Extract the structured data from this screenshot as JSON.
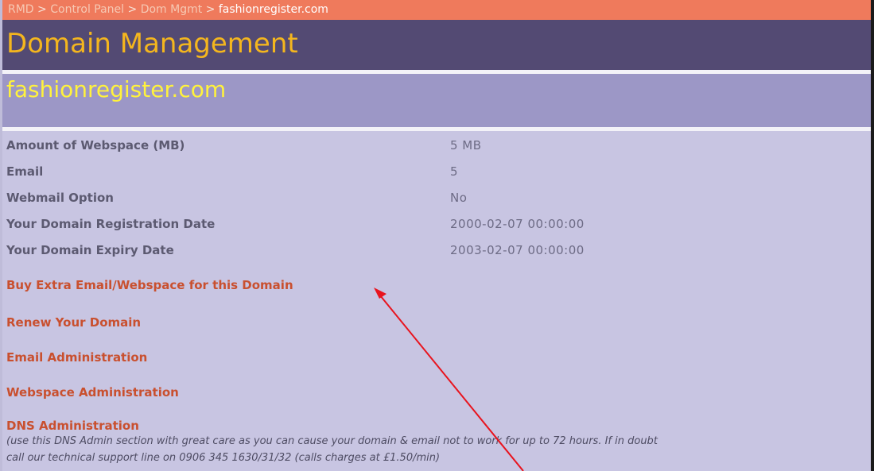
{
  "breadcrumb": {
    "items": [
      "RMD",
      "Control Panel",
      "Dom Mgmt"
    ],
    "separator": ">",
    "current": "fashionregister.com"
  },
  "page_title": "Domain Management",
  "domain_name": "fashionregister.com",
  "details": [
    {
      "label": "Amount of Webspace (MB)",
      "value": "5 MB"
    },
    {
      "label": "Email",
      "value": "5"
    },
    {
      "label": "Webmail Option",
      "value": "No"
    },
    {
      "label": "Your Domain Registration Date",
      "value": "2000-02-07 00:00:00"
    },
    {
      "label": "Your Domain Expiry Date",
      "value": "2003-02-07 00:00:00"
    }
  ],
  "links": {
    "buy_extra": "Buy Extra Email/Webspace for this Domain",
    "renew": "Renew Your Domain",
    "email_admin": "Email Administration",
    "webspace_admin": "Webspace Administration",
    "dns_admin": "DNS Administration"
  },
  "dns_note": {
    "line1": "(use this DNS Admin section with great care as you can cause your domain & email not to work for up to 72 hours. If in doubt",
    "line2": "call our technical support line on 0906 345 1630/31/32 (calls charges at £1.50/min)"
  },
  "colors": {
    "crumb_bar": "#ef7a5c",
    "title_bar": "#534a73",
    "title_text": "#f4b61e",
    "domain_bar": "#9c97c6",
    "domain_text": "#fff23c",
    "content_bg": "#c8c5e2",
    "link_text": "#c9502f",
    "annotation_arrow": "#e8141e"
  }
}
